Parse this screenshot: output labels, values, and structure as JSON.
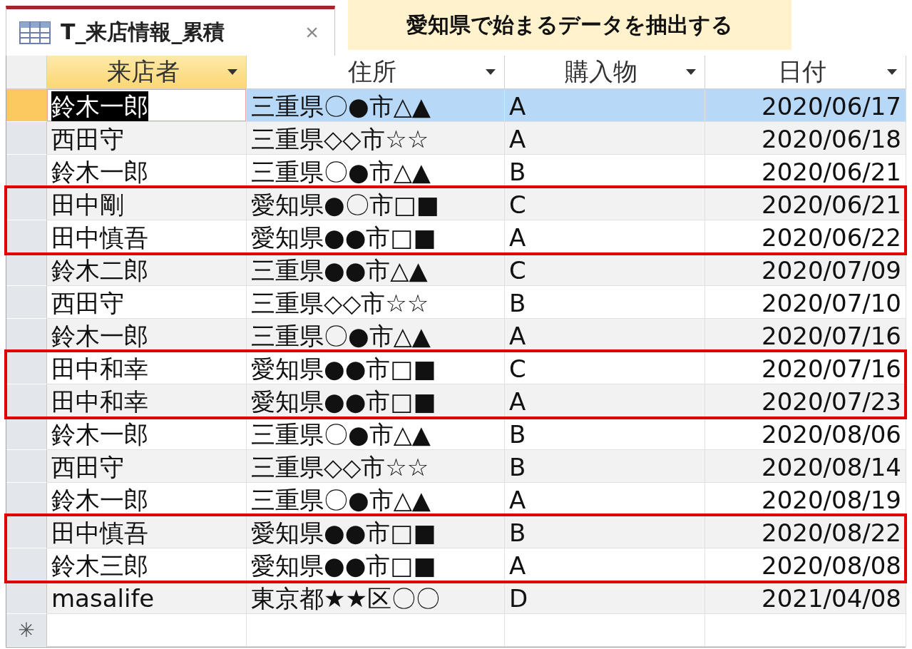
{
  "tab": {
    "title": "T_来店情報_累積",
    "close": "×",
    "selected": true
  },
  "callout": "愛知県で始まるデータを抽出する",
  "columns": [
    {
      "label": "来店者",
      "selected": true,
      "kind": "text"
    },
    {
      "label": "住所",
      "selected": false,
      "kind": "text"
    },
    {
      "label": "購入物",
      "selected": false,
      "kind": "text"
    },
    {
      "label": "日付",
      "selected": false,
      "kind": "date"
    }
  ],
  "rows": [
    {
      "cells": [
        "鈴木一郎",
        "三重県〇●市△▲",
        "A",
        "2020/06/17"
      ],
      "selected": true,
      "highlighted": false
    },
    {
      "cells": [
        "西田守",
        "三重県◇◇市☆☆",
        "A",
        "2020/06/18"
      ],
      "selected": false,
      "highlighted": false
    },
    {
      "cells": [
        "鈴木一郎",
        "三重県〇●市△▲",
        "B",
        "2020/06/21"
      ],
      "selected": false,
      "highlighted": false
    },
    {
      "cells": [
        "田中剛",
        "愛知県●〇市□■",
        "C",
        "2020/06/21"
      ],
      "selected": false,
      "highlighted": true
    },
    {
      "cells": [
        "田中慎吾",
        "愛知県●●市□■",
        "A",
        "2020/06/22"
      ],
      "selected": false,
      "highlighted": true
    },
    {
      "cells": [
        "鈴木二郎",
        "三重県●●市△▲",
        "C",
        "2020/07/09"
      ],
      "selected": false,
      "highlighted": false
    },
    {
      "cells": [
        "西田守",
        "三重県◇◇市☆☆",
        "B",
        "2020/07/10"
      ],
      "selected": false,
      "highlighted": false
    },
    {
      "cells": [
        "鈴木一郎",
        "三重県〇●市△▲",
        "A",
        "2020/07/16"
      ],
      "selected": false,
      "highlighted": false
    },
    {
      "cells": [
        "田中和幸",
        "愛知県●●市□■",
        "C",
        "2020/07/16"
      ],
      "selected": false,
      "highlighted": true
    },
    {
      "cells": [
        "田中和幸",
        "愛知県●●市□■",
        "A",
        "2020/07/23"
      ],
      "selected": false,
      "highlighted": true
    },
    {
      "cells": [
        "鈴木一郎",
        "三重県〇●市△▲",
        "B",
        "2020/08/06"
      ],
      "selected": false,
      "highlighted": false
    },
    {
      "cells": [
        "西田守",
        "三重県◇◇市☆☆",
        "B",
        "2020/08/14"
      ],
      "selected": false,
      "highlighted": false
    },
    {
      "cells": [
        "鈴木一郎",
        "三重県〇●市△▲",
        "A",
        "2020/08/19"
      ],
      "selected": false,
      "highlighted": false
    },
    {
      "cells": [
        "田中慎吾",
        "愛知県●●市□■",
        "B",
        "2020/08/22"
      ],
      "selected": false,
      "highlighted": true
    },
    {
      "cells": [
        "鈴木三郎",
        "愛知県●●市□■",
        "A",
        "2020/08/08"
      ],
      "selected": false,
      "highlighted": true
    },
    {
      "cells": [
        "masalife",
        "東京都★★区〇〇",
        "D",
        "2021/04/08"
      ],
      "selected": false,
      "highlighted": false
    }
  ],
  "new_row": {
    "marker": "✳"
  }
}
